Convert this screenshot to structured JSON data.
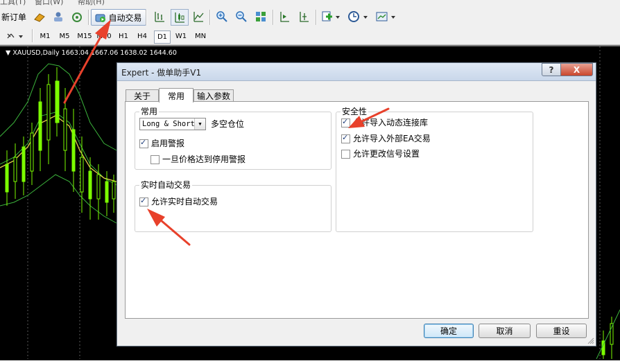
{
  "menubar": {
    "items": [
      "工具(T)",
      "窗口(W)",
      "帮助(H)"
    ]
  },
  "toolbar": {
    "new_order_label": "新订单",
    "auto_trading_label": "自动交易"
  },
  "timeframes": {
    "items": [
      "M1",
      "M5",
      "M15",
      "M30",
      "H1",
      "H4",
      "D1",
      "W1",
      "MN"
    ],
    "active": "D1"
  },
  "chart": {
    "title": "XAUUSD,Daily  1663.04 1667.06 1638.02 1644.60"
  },
  "dialog": {
    "title": "Expert - 做单助手V1",
    "help_label": "?",
    "close_label": "X",
    "tabs": [
      "关于",
      "常用",
      "输入参数"
    ],
    "active_tab": "常用",
    "common": {
      "group_label": "常用",
      "position_select": "Long & Short",
      "position_label": "多空仓位",
      "enable_alerts": {
        "label": "启用警报",
        "checked": true
      },
      "disable_alert": {
        "label": "一旦价格达到停用警报",
        "checked": false
      }
    },
    "live": {
      "group_label": "实时自动交易",
      "allow_live": {
        "label": "允许实时自动交易",
        "checked": true
      }
    },
    "safety": {
      "group_label": "安全性",
      "allow_dll": {
        "label": "允许导入动态连接库",
        "checked": true
      },
      "allow_ext": {
        "label": "允许导入外部EA交易",
        "checked": true
      },
      "allow_signal": {
        "label": "允许更改信号设置",
        "checked": false
      }
    },
    "buttons": {
      "ok": "确定",
      "cancel": "取消",
      "reset": "重设"
    }
  },
  "colors": {
    "annotation_arrow": "#e8412b",
    "chart_bg": "#000000",
    "candle": "#7cfc00",
    "band": "#3cb43c",
    "ma": "#e5d24a"
  }
}
